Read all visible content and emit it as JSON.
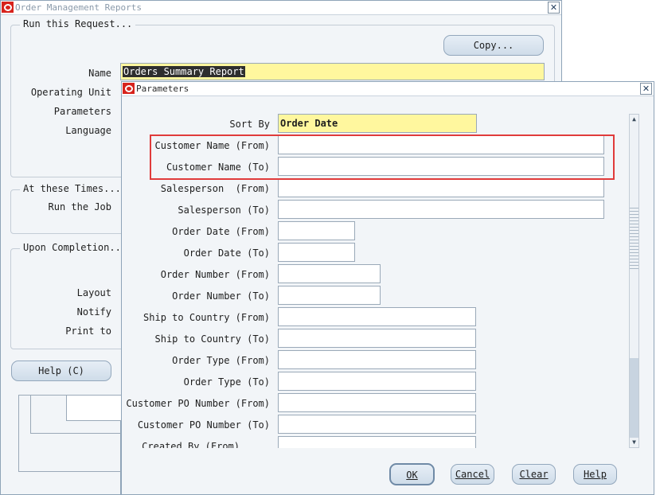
{
  "back_window": {
    "title": "Order Management Reports",
    "run_request_legend": "Run this Request...",
    "copy_button": "Copy...",
    "name_label": "Name",
    "name_value": "Orders Summary Report",
    "operating_unit_label": "Operating Unit",
    "parameters_label": "Parameters",
    "language_label": "Language",
    "at_times_legend": "At these Times...",
    "run_job_label": "Run the Job",
    "upon_completion_legend": "Upon Completion...",
    "layout_label": "Layout",
    "notify_label": "Notify",
    "print_to_label": "Print to",
    "help_button": "Help (C)"
  },
  "dialog": {
    "title": "Parameters",
    "sort_by_label": "Sort By",
    "sort_by_value": "Order Date",
    "params": [
      "Customer Name (From)",
      "Customer Name (To)",
      "Salesperson  (From)",
      "Salesperson (To)",
      "Order Date (From)",
      "Order Date (To)",
      "Order Number (From)",
      "Order Number (To)",
      "Ship to Country (From)",
      "Ship to Country (To)",
      "Order Type (From)",
      "Order Type (To)",
      "Customer PO Number (From)",
      "Customer PO Number (To)",
      "Created By (From)"
    ],
    "buttons": {
      "ok": "OK",
      "cancel": "Cancel",
      "clear": "Clear",
      "help": "Help"
    }
  },
  "colors": {
    "highlight_box": "#e03b3b",
    "required_field": "#fff79e"
  }
}
